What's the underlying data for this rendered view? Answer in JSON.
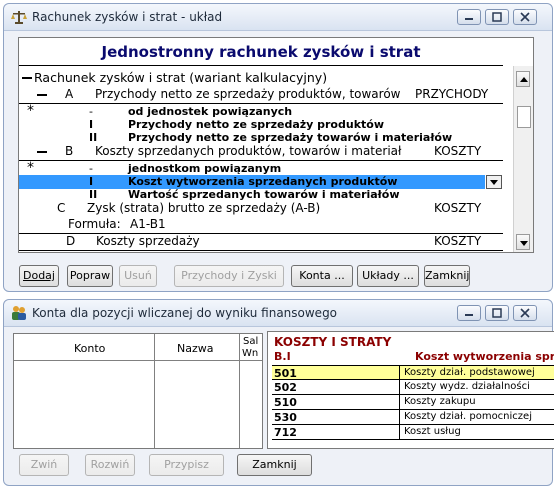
{
  "window1": {
    "title": "Rachunek zysków i strat - układ",
    "header": "Jednostronny rachunek zysków i strat",
    "rows": [
      {
        "marker": "",
        "col1": "Rachunek zysków i strat (wariant kalkulacyjny)",
        "col2": "",
        "col3": ""
      },
      {
        "marker": "",
        "col1": "A",
        "col2": "Przychody netto ze sprzedaży produktów, towarów",
        "col3": "PRZYCHODY"
      },
      {
        "marker": "*",
        "col1": "-",
        "col2": "od jednostek powiązanych",
        "col3": ""
      },
      {
        "marker": "",
        "col1": "I",
        "col2": "Przychody netto ze sprzedaży produktów",
        "col3": ""
      },
      {
        "marker": "",
        "col1": "II",
        "col2": "Przychody netto ze sprzedaży towarów i materiałów",
        "col3": ""
      },
      {
        "marker": "",
        "col1": "B",
        "col2": "Koszty sprzedanych produktów, towarów i materiał",
        "col3": "KOSZTY"
      },
      {
        "marker": "*",
        "col1": "-",
        "col2": "jednostkom powiązanym",
        "col3": ""
      },
      {
        "marker": "",
        "col1": "I",
        "col2": "Koszt wytworzenia sprzedanych produktów",
        "col3": ""
      },
      {
        "marker": "",
        "col1": "II",
        "col2": "Wartość sprzedanych towarów i materiałów",
        "col3": ""
      },
      {
        "marker": "",
        "col1": "C",
        "col2": "Zysk (strata) brutto ze sprzedaży (A-B)",
        "col3": "KOSZTY"
      },
      {
        "marker": "",
        "col1": "Formuła:",
        "col2": "A1-B1",
        "col3": ""
      },
      {
        "marker": "",
        "col1": "D",
        "col2": "Koszty sprzedaży",
        "col3": "KOSZTY"
      }
    ],
    "buttons": {
      "add": "Dodaj",
      "fix": "Popraw",
      "delete": "Usuń",
      "revenues": "Przychody i Zyski",
      "accounts": "Konta ...",
      "layouts": "Układy ...",
      "close": "Zamknij"
    }
  },
  "window2": {
    "title": "Konta dla pozycji wliczanej do wyniku finansowego",
    "left_table": {
      "columns": [
        "Konto",
        "Nazwa",
        "Sal",
        "Wn"
      ]
    },
    "right_panel": {
      "title": "KOSZTY I STRATY",
      "code": "B.I",
      "desc": "Koszt wytworzenia sprz",
      "rows": [
        {
          "account": "501",
          "name": "Koszty dział. podstawowej"
        },
        {
          "account": "502",
          "name": "Koszty wydz. działalności"
        },
        {
          "account": "510",
          "name": "Koszty zakupu"
        },
        {
          "account": "530",
          "name": "Koszty dział. pomocniczej"
        },
        {
          "account": "712",
          "name": "Koszt usług"
        }
      ]
    },
    "buttons": {
      "collapse": "Zwiń",
      "expand": "Rozwiń",
      "assign": "Przypisz",
      "close": "Zamknij"
    }
  },
  "colors": {
    "selection": "#3399ff",
    "header_text": "#0a0a6e",
    "highlight_row": "#ffff99",
    "right_title": "#8b0000"
  }
}
